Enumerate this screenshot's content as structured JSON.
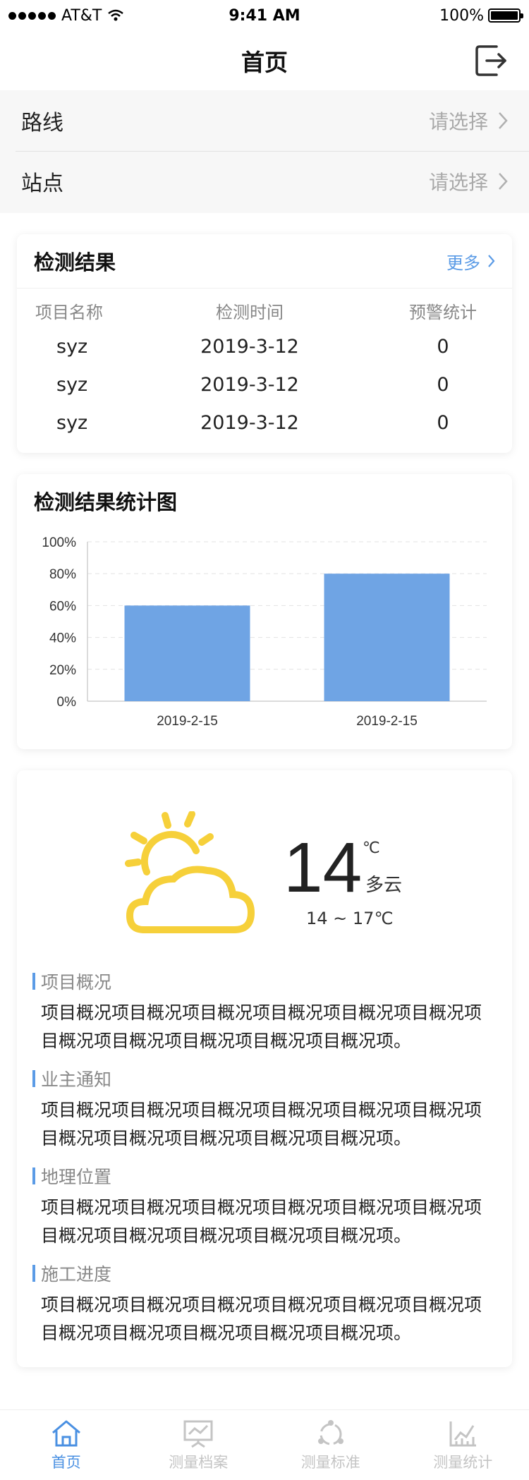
{
  "status_bar": {
    "carrier": "AT&T",
    "time": "9:41 AM",
    "battery": "100%"
  },
  "nav": {
    "title": "首页",
    "logout_icon": "logout-icon"
  },
  "selectors": [
    {
      "label": "路线",
      "placeholder": "请选择"
    },
    {
      "label": "站点",
      "placeholder": "请选择"
    }
  ],
  "results": {
    "title": "检测结果",
    "more": "更多",
    "columns": [
      "项目名称",
      "检测时间",
      "预警统计"
    ],
    "rows": [
      [
        "syz",
        "2019-3-12",
        "0"
      ],
      [
        "syz",
        "2019-3-12",
        "0"
      ],
      [
        "syz",
        "2019-3-12",
        "0"
      ]
    ]
  },
  "chart_title": "检测结果统计图",
  "chart_data": {
    "type": "bar",
    "title": "检测结果统计图",
    "categories": [
      "2019-2-15",
      "2019-2-15"
    ],
    "values": [
      60,
      80
    ],
    "ylim": [
      0,
      100
    ],
    "yticks": [
      "0%",
      "20%",
      "40%",
      "60%",
      "80%",
      "100%"
    ],
    "color": "#6fa4e4",
    "grid": true
  },
  "weather": {
    "icon": "partly-cloudy-icon",
    "temp": "14",
    "unit": "℃",
    "desc": "多云",
    "range": "14 ~ 17℃",
    "icon_color": "#f6d03a"
  },
  "info": [
    {
      "heading": "项目概况",
      "body": "项目概况项目概况项目概况项目概况项目概况项目概况项目概况项目概况项目概况项目概况项目概况项。"
    },
    {
      "heading": "业主通知",
      "body": "项目概况项目概况项目概况项目概况项目概况项目概况项目概况项目概况项目概况项目概况项目概况项。"
    },
    {
      "heading": "地理位置",
      "body": "项目概况项目概况项目概况项目概况项目概况项目概况项目概况项目概况项目概况项目概况项目概况项。"
    },
    {
      "heading": "施工进度",
      "body": "项目概况项目概况项目概况项目概况项目概况项目概况项目概况项目概况项目概况项目概况项目概况项。"
    }
  ],
  "tabs": [
    {
      "label": "首页",
      "icon": "home-icon",
      "active": true
    },
    {
      "label": "测量档案",
      "icon": "archive-chart-icon",
      "active": false
    },
    {
      "label": "测量标准",
      "icon": "standard-icon",
      "active": false
    },
    {
      "label": "测量统计",
      "icon": "statistics-icon",
      "active": false
    }
  ],
  "colors": {
    "accent": "#4a90e2",
    "bar": "#6fa4e4",
    "sun": "#f6d03a"
  }
}
